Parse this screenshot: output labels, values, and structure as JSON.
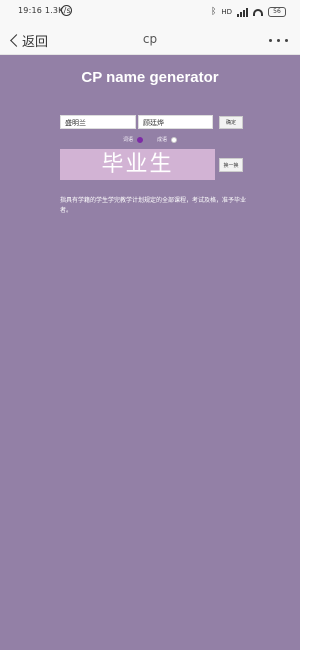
{
  "status_bar": {
    "time": "19:16",
    "net_speed": "1.3K/s",
    "hd_label": "HD",
    "battery": "56"
  },
  "nav": {
    "back_label": "返回",
    "title": "cp"
  },
  "app": {
    "title": "CP name generator",
    "name1": "盛明兰",
    "name2": "顾廷烨",
    "confirm_label": "确定",
    "mode_options": [
      {
        "label": "词语",
        "selected": true
      },
      {
        "label": "成语",
        "selected": false
      }
    ],
    "result": "毕业生",
    "refresh_label": "换一换",
    "description": "指具有学籍的学生学完教学计划规定的全部课程，考试及格，准予毕业者。"
  },
  "colors": {
    "background": "#9380a6",
    "result_box": "#d2b3d4",
    "radio_selected": "#7d2aa6"
  }
}
